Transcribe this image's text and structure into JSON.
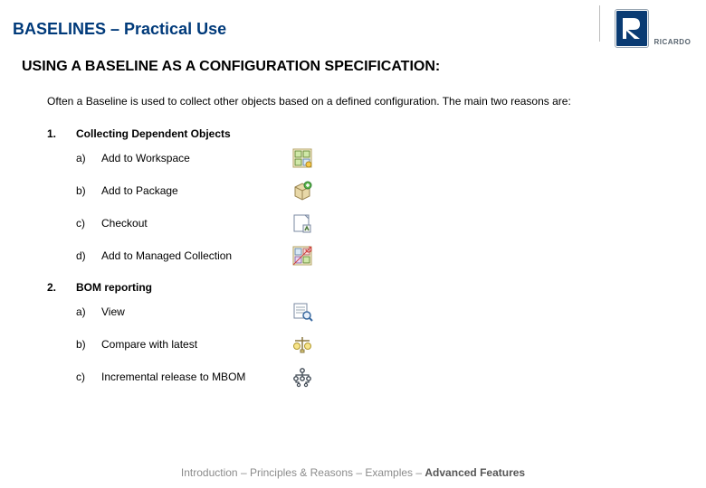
{
  "header": {
    "title": "BASELINES – Practical Use",
    "logo_text": "RICARDO"
  },
  "subtitle": "USING A BASELINE AS A CONFIGURATION SPECIFICATION:",
  "intro": "Often a Baseline is used to collect other objects based on a defined configuration. The main two reasons are:",
  "sections": [
    {
      "num": "1.",
      "label": "Collecting Dependent Objects",
      "items": [
        {
          "letter": "a)",
          "label": "Add to Workspace",
          "icon": "workspace-icon"
        },
        {
          "letter": "b)",
          "label": "Add to Package",
          "icon": "package-icon"
        },
        {
          "letter": "c)",
          "label": "Checkout",
          "icon": "checkout-icon"
        },
        {
          "letter": "d)",
          "label": "Add to Managed Collection",
          "icon": "collection-icon"
        }
      ]
    },
    {
      "num": "2.",
      "label": "BOM reporting",
      "items": [
        {
          "letter": "a)",
          "label": "View",
          "icon": "view-icon"
        },
        {
          "letter": "b)",
          "label": "Compare with latest",
          "icon": "compare-icon"
        },
        {
          "letter": "c)",
          "label": "Incremental release to MBOM",
          "icon": "tree-icon"
        }
      ]
    }
  ],
  "footer": {
    "parts": [
      "Introduction",
      " – ",
      "Principles & Reasons",
      " – ",
      "Examples",
      " – "
    ],
    "bold": "Advanced Features"
  }
}
